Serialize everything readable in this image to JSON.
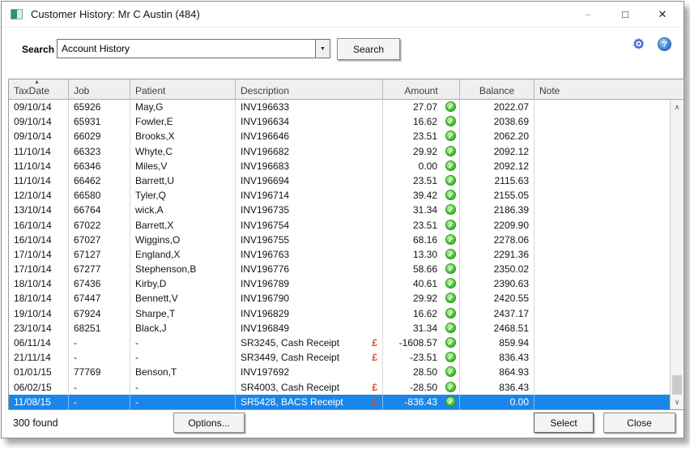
{
  "window": {
    "title": "Customer History: Mr C Austin (484)",
    "minimize_glyph": "–",
    "maximize_glyph": "□",
    "close_glyph": "✕"
  },
  "search": {
    "label": "Search",
    "dropdown_value": "Account History",
    "dropdown_arrow": "▼",
    "button_label": "Search"
  },
  "icons": {
    "gear": "⚙",
    "help": "?",
    "check": "✓",
    "sort_asc": "▲",
    "scroll_up": "∧",
    "scroll_down": "∨",
    "pound": "£"
  },
  "colors": {
    "selection_blue": "#1b86ea",
    "pound_red": "#e04a22",
    "check_green": "#2f9e27",
    "header_bg": "#f1efee"
  },
  "table": {
    "columns": [
      {
        "label": "TaxDate",
        "sorted": "asc"
      },
      {
        "label": "Job"
      },
      {
        "label": "Patient"
      },
      {
        "label": "Description"
      },
      {
        "label": "Amount"
      },
      {
        "label": "Balance"
      },
      {
        "label": "Note"
      }
    ],
    "rows": [
      {
        "taxdate": "09/10/14",
        "job": "65926",
        "patient": "May,G",
        "description": "INV196633",
        "pound": false,
        "amount": "27.07",
        "check": true,
        "balance": "2022.07",
        "note": "",
        "selected": false
      },
      {
        "taxdate": "09/10/14",
        "job": "65931",
        "patient": "Fowler,E",
        "description": "INV196634",
        "pound": false,
        "amount": "16.62",
        "check": true,
        "balance": "2038.69",
        "note": "",
        "selected": false
      },
      {
        "taxdate": "09/10/14",
        "job": "66029",
        "patient": "Brooks,X",
        "description": "INV196646",
        "pound": false,
        "amount": "23.51",
        "check": true,
        "balance": "2062.20",
        "note": "",
        "selected": false
      },
      {
        "taxdate": "11/10/14",
        "job": "66323",
        "patient": "Whyte,C",
        "description": "INV196682",
        "pound": false,
        "amount": "29.92",
        "check": true,
        "balance": "2092.12",
        "note": "",
        "selected": false
      },
      {
        "taxdate": "11/10/14",
        "job": "66346",
        "patient": "Miles,V",
        "description": "INV196683",
        "pound": false,
        "amount": "0.00",
        "check": true,
        "balance": "2092.12",
        "note": "",
        "selected": false
      },
      {
        "taxdate": "11/10/14",
        "job": "66462",
        "patient": "Barrett,U",
        "description": "INV196694",
        "pound": false,
        "amount": "23.51",
        "check": true,
        "balance": "2115.63",
        "note": "",
        "selected": false
      },
      {
        "taxdate": "12/10/14",
        "job": "66580",
        "patient": "Tyler,Q",
        "description": "INV196714",
        "pound": false,
        "amount": "39.42",
        "check": true,
        "balance": "2155.05",
        "note": "",
        "selected": false
      },
      {
        "taxdate": "13/10/14",
        "job": "66764",
        "patient": "wick,A",
        "description": "INV196735",
        "pound": false,
        "amount": "31.34",
        "check": true,
        "balance": "2186.39",
        "note": "",
        "selected": false
      },
      {
        "taxdate": "16/10/14",
        "job": "67022",
        "patient": "Barrett,X",
        "description": "INV196754",
        "pound": false,
        "amount": "23.51",
        "check": true,
        "balance": "2209.90",
        "note": "",
        "selected": false
      },
      {
        "taxdate": "16/10/14",
        "job": "67027",
        "patient": "Wiggins,O",
        "description": "INV196755",
        "pound": false,
        "amount": "68.16",
        "check": true,
        "balance": "2278.06",
        "note": "",
        "selected": false
      },
      {
        "taxdate": "17/10/14",
        "job": "67127",
        "patient": "England,X",
        "description": "INV196763",
        "pound": false,
        "amount": "13.30",
        "check": true,
        "balance": "2291.36",
        "note": "",
        "selected": false
      },
      {
        "taxdate": "17/10/14",
        "job": "67277",
        "patient": "Stephenson,B",
        "description": "INV196776",
        "pound": false,
        "amount": "58.66",
        "check": true,
        "balance": "2350.02",
        "note": "",
        "selected": false
      },
      {
        "taxdate": "18/10/14",
        "job": "67436",
        "patient": "Kirby,D",
        "description": "INV196789",
        "pound": false,
        "amount": "40.61",
        "check": true,
        "balance": "2390.63",
        "note": "",
        "selected": false
      },
      {
        "taxdate": "18/10/14",
        "job": "67447",
        "patient": "Bennett,V",
        "description": "INV196790",
        "pound": false,
        "amount": "29.92",
        "check": true,
        "balance": "2420.55",
        "note": "",
        "selected": false
      },
      {
        "taxdate": "19/10/14",
        "job": "67924",
        "patient": "Sharpe,T",
        "description": "INV196829",
        "pound": false,
        "amount": "16.62",
        "check": true,
        "balance": "2437.17",
        "note": "",
        "selected": false
      },
      {
        "taxdate": "23/10/14",
        "job": "68251",
        "patient": "Black,J",
        "description": "INV196849",
        "pound": false,
        "amount": "31.34",
        "check": true,
        "balance": "2468.51",
        "note": "",
        "selected": false
      },
      {
        "taxdate": "06/11/14",
        "job": "-",
        "patient": "-",
        "description": "SR3245, Cash Receipt",
        "pound": true,
        "amount": "-1608.57",
        "check": true,
        "balance": "859.94",
        "note": "",
        "selected": false
      },
      {
        "taxdate": "21/11/14",
        "job": "-",
        "patient": "-",
        "description": "SR3449, Cash Receipt",
        "pound": true,
        "amount": "-23.51",
        "check": true,
        "balance": "836.43",
        "note": "",
        "selected": false
      },
      {
        "taxdate": "01/01/15",
        "job": "77769",
        "patient": "Benson,T",
        "description": "INV197692",
        "pound": false,
        "amount": "28.50",
        "check": true,
        "balance": "864.93",
        "note": "",
        "selected": false
      },
      {
        "taxdate": "06/02/15",
        "job": "-",
        "patient": "-",
        "description": "SR4003, Cash Receipt",
        "pound": true,
        "amount": "-28.50",
        "check": true,
        "balance": "836.43",
        "note": "",
        "selected": false
      },
      {
        "taxdate": "11/08/15",
        "job": "-",
        "patient": "-",
        "description": "SR5428, BACS Receipt",
        "pound": true,
        "amount": "-836.43",
        "check": true,
        "balance": "0.00",
        "note": "",
        "selected": true
      }
    ]
  },
  "footer": {
    "count_text": "300 found",
    "options_label": "Options...",
    "select_label": "Select",
    "close_label": "Close"
  }
}
